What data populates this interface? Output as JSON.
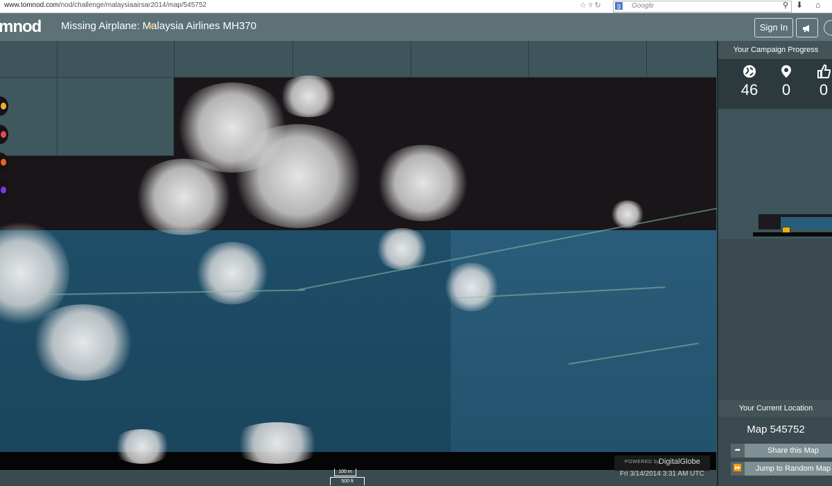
{
  "browser": {
    "url_host": "www.tomnod.com",
    "url_path": "/nod/challenge/malaysiaairsar2014/map/545752",
    "search_placeholder": "Google",
    "icons": [
      "star-icon",
      "dropdown-icon",
      "refresh-icon",
      "google-icon",
      "magnifier-icon",
      "download-icon",
      "home-icon"
    ]
  },
  "header": {
    "logo": "mnod",
    "title": "Missing Airplane: Malaysia Airlines MH370",
    "signin_label": "Sign In"
  },
  "map": {
    "powered_by": "POWERED by",
    "provider": "DigitalGlobe",
    "timestamp": "Fri 3/14/2014 3:31 AM UTC",
    "scale_top": "100 m",
    "scale_bottom": "500 ft",
    "tools": [
      "tool-1",
      "tool-2",
      "tool-3",
      "tool-4"
    ]
  },
  "panel": {
    "progress_title": "Your Campaign Progress",
    "stats": [
      {
        "icon": "globe-icon",
        "value": "46"
      },
      {
        "icon": "map-pin-icon",
        "value": "0"
      },
      {
        "icon": "thumbs-up-icon",
        "value": "0"
      }
    ],
    "location_title": "Your Current Location",
    "map_id": "Map 545752",
    "share_label": "Share this Map",
    "jump_label": "Jump to Random Map"
  },
  "colors": {
    "header_bg": "#5d7176",
    "panel_bg": "#3a4a4f",
    "ocean": "#1f4e68",
    "accent": "#f09a2a"
  }
}
